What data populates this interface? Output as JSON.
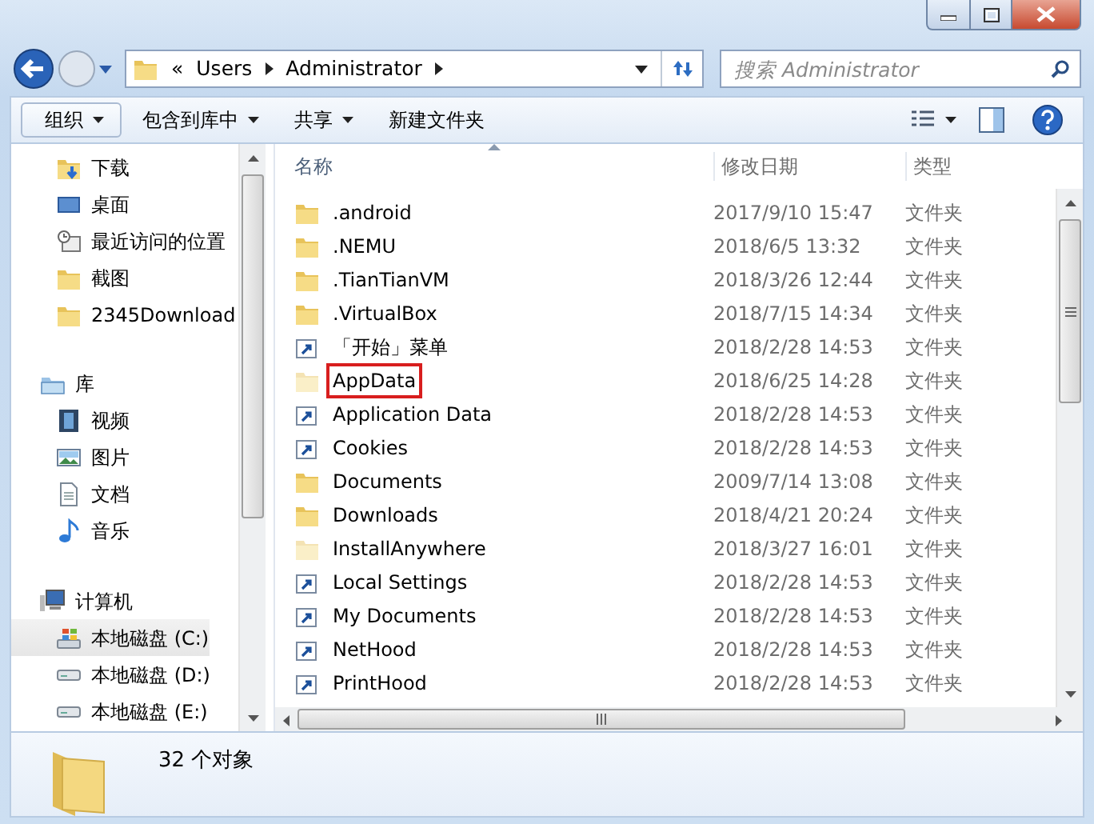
{
  "address": {
    "overflow": "«",
    "crumbs": [
      "Users",
      "Administrator"
    ]
  },
  "search": {
    "placeholder": "搜索 Administrator"
  },
  "toolbar": [
    {
      "label": "组织",
      "dropdown": true,
      "bordered": true
    },
    {
      "label": "包含到库中",
      "dropdown": true,
      "bordered": false
    },
    {
      "label": "共享",
      "dropdown": true,
      "bordered": false
    },
    {
      "label": "新建文件夹",
      "dropdown": false,
      "bordered": false
    }
  ],
  "nav": [
    {
      "items": [
        {
          "label": "下载",
          "kind": "download",
          "selected": false
        },
        {
          "label": "桌面",
          "kind": "desktop",
          "selected": false
        },
        {
          "label": "最近访问的位置",
          "kind": "recent",
          "selected": false
        },
        {
          "label": "截图",
          "kind": "folder",
          "selected": false
        },
        {
          "label": "2345Download",
          "kind": "folder",
          "selected": false
        }
      ]
    },
    {
      "label": "库",
      "kind": "library",
      "items": [
        {
          "label": "视频",
          "kind": "video",
          "selected": false
        },
        {
          "label": "图片",
          "kind": "picture",
          "selected": false
        },
        {
          "label": "文档",
          "kind": "document",
          "selected": false
        },
        {
          "label": "音乐",
          "kind": "music",
          "selected": false
        }
      ]
    },
    {
      "label": "计算机",
      "kind": "computer",
      "items": [
        {
          "label": "本地磁盘 (C:)",
          "kind": "system-drive",
          "selected": true
        },
        {
          "label": "本地磁盘 (D:)",
          "kind": "drive",
          "selected": false
        },
        {
          "label": "本地磁盘 (E:)",
          "kind": "drive",
          "selected": false
        }
      ]
    }
  ],
  "table": {
    "columns": [
      "名称",
      "修改日期",
      "类型"
    ],
    "rows": [
      {
        "name": ".android",
        "date": "2017/9/10 15:47",
        "type": "文件夹",
        "kind": "folder",
        "highlighted": false
      },
      {
        "name": ".NEMU",
        "date": "2018/6/5 13:32",
        "type": "文件夹",
        "kind": "folder",
        "highlighted": false
      },
      {
        "name": ".TianTianVM",
        "date": "2018/3/26 12:44",
        "type": "文件夹",
        "kind": "folder",
        "highlighted": false
      },
      {
        "name": ".VirtualBox",
        "date": "2018/7/15 14:34",
        "type": "文件夹",
        "kind": "folder",
        "highlighted": false
      },
      {
        "name": "「开始」菜单",
        "date": "2018/2/28 14:53",
        "type": "文件夹",
        "kind": "shortcut",
        "highlighted": false
      },
      {
        "name": "AppData",
        "date": "2018/6/25 14:28",
        "type": "文件夹",
        "kind": "hidden",
        "highlighted": true
      },
      {
        "name": "Application Data",
        "date": "2018/2/28 14:53",
        "type": "文件夹",
        "kind": "shortcut",
        "highlighted": false
      },
      {
        "name": "Cookies",
        "date": "2018/2/28 14:53",
        "type": "文件夹",
        "kind": "shortcut",
        "highlighted": false
      },
      {
        "name": "Documents",
        "date": "2009/7/14 13:08",
        "type": "文件夹",
        "kind": "folder",
        "highlighted": false
      },
      {
        "name": "Downloads",
        "date": "2018/4/21 20:24",
        "type": "文件夹",
        "kind": "folder",
        "highlighted": false
      },
      {
        "name": "InstallAnywhere",
        "date": "2018/3/27 16:01",
        "type": "文件夹",
        "kind": "hidden",
        "highlighted": false
      },
      {
        "name": "Local Settings",
        "date": "2018/2/28 14:53",
        "type": "文件夹",
        "kind": "shortcut",
        "highlighted": false
      },
      {
        "name": "My Documents",
        "date": "2018/2/28 14:53",
        "type": "文件夹",
        "kind": "shortcut",
        "highlighted": false
      },
      {
        "name": "NetHood",
        "date": "2018/2/28 14:53",
        "type": "文件夹",
        "kind": "shortcut",
        "highlighted": false
      },
      {
        "name": "PrintHood",
        "date": "2018/2/28 14:53",
        "type": "文件夹",
        "kind": "shortcut",
        "highlighted": false
      }
    ]
  },
  "status": {
    "count": "32 个对象"
  }
}
